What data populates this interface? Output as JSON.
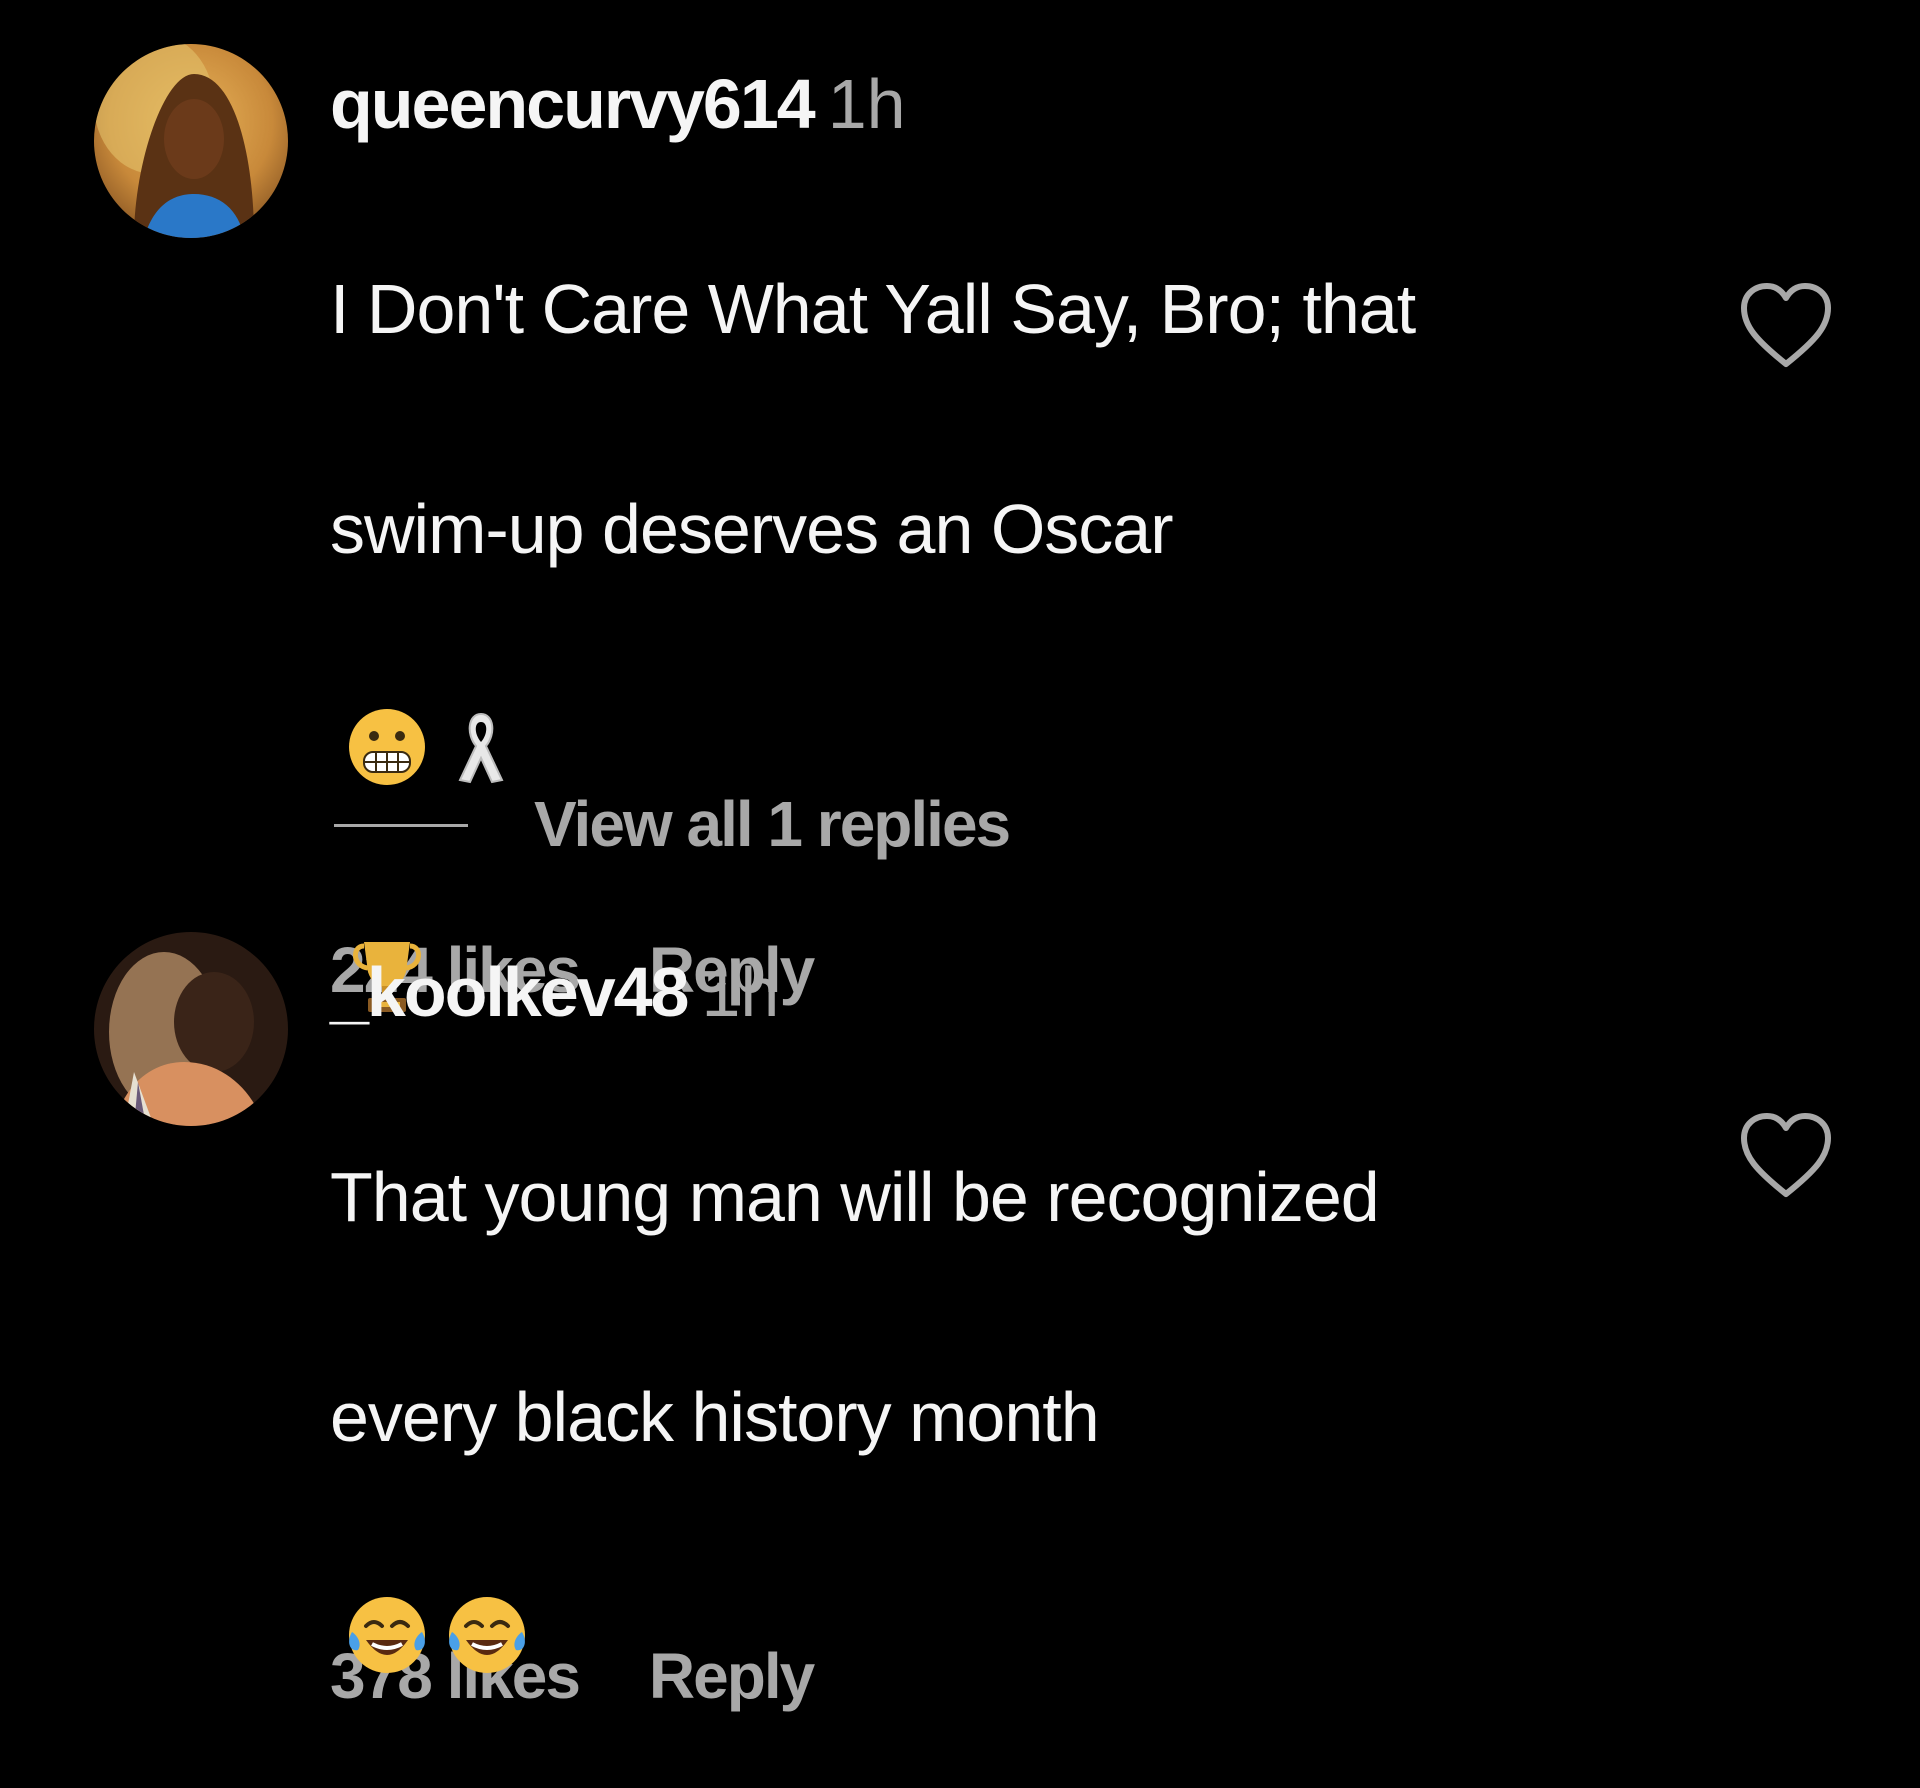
{
  "comments": [
    {
      "username": "queencurvy614",
      "timestamp": "1h",
      "text_line1": "I Don't Care What Yall Say, Bro; that",
      "text_line2": "swim-up deserves an Oscar",
      "emojis": [
        "grimacing-face",
        "ribbon",
        "trophy"
      ],
      "likes": "224 likes",
      "reply_label": "Reply",
      "view_replies": "View all 1 replies"
    },
    {
      "username": "_koolkev48",
      "timestamp": "1h",
      "text_line1": "That young man will be recognized",
      "text_line2": "every black history month",
      "emojis": [
        "face-with-tears-of-joy",
        "face-with-tears-of-joy"
      ],
      "likes": "378 likes",
      "reply_label": "Reply"
    }
  ],
  "colors": {
    "background": "#000000",
    "primary_text": "#f5f5f5",
    "secondary_text": "#a8a8a8"
  }
}
